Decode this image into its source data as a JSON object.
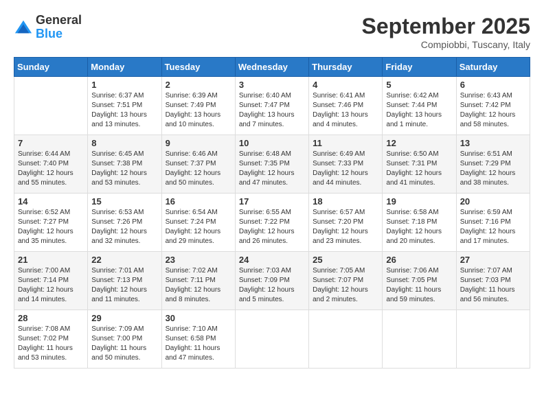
{
  "logo": {
    "general": "General",
    "blue": "Blue"
  },
  "header": {
    "month": "September 2025",
    "location": "Compiobbi, Tuscany, Italy"
  },
  "days_of_week": [
    "Sunday",
    "Monday",
    "Tuesday",
    "Wednesday",
    "Thursday",
    "Friday",
    "Saturday"
  ],
  "weeks": [
    [
      {
        "day": "",
        "sunrise": "",
        "sunset": "",
        "daylight": ""
      },
      {
        "day": "1",
        "sunrise": "Sunrise: 6:37 AM",
        "sunset": "Sunset: 7:51 PM",
        "daylight": "Daylight: 13 hours and 13 minutes."
      },
      {
        "day": "2",
        "sunrise": "Sunrise: 6:39 AM",
        "sunset": "Sunset: 7:49 PM",
        "daylight": "Daylight: 13 hours and 10 minutes."
      },
      {
        "day": "3",
        "sunrise": "Sunrise: 6:40 AM",
        "sunset": "Sunset: 7:47 PM",
        "daylight": "Daylight: 13 hours and 7 minutes."
      },
      {
        "day": "4",
        "sunrise": "Sunrise: 6:41 AM",
        "sunset": "Sunset: 7:46 PM",
        "daylight": "Daylight: 13 hours and 4 minutes."
      },
      {
        "day": "5",
        "sunrise": "Sunrise: 6:42 AM",
        "sunset": "Sunset: 7:44 PM",
        "daylight": "Daylight: 13 hours and 1 minute."
      },
      {
        "day": "6",
        "sunrise": "Sunrise: 6:43 AM",
        "sunset": "Sunset: 7:42 PM",
        "daylight": "Daylight: 12 hours and 58 minutes."
      }
    ],
    [
      {
        "day": "7",
        "sunrise": "Sunrise: 6:44 AM",
        "sunset": "Sunset: 7:40 PM",
        "daylight": "Daylight: 12 hours and 55 minutes."
      },
      {
        "day": "8",
        "sunrise": "Sunrise: 6:45 AM",
        "sunset": "Sunset: 7:38 PM",
        "daylight": "Daylight: 12 hours and 53 minutes."
      },
      {
        "day": "9",
        "sunrise": "Sunrise: 6:46 AM",
        "sunset": "Sunset: 7:37 PM",
        "daylight": "Daylight: 12 hours and 50 minutes."
      },
      {
        "day": "10",
        "sunrise": "Sunrise: 6:48 AM",
        "sunset": "Sunset: 7:35 PM",
        "daylight": "Daylight: 12 hours and 47 minutes."
      },
      {
        "day": "11",
        "sunrise": "Sunrise: 6:49 AM",
        "sunset": "Sunset: 7:33 PM",
        "daylight": "Daylight: 12 hours and 44 minutes."
      },
      {
        "day": "12",
        "sunrise": "Sunrise: 6:50 AM",
        "sunset": "Sunset: 7:31 PM",
        "daylight": "Daylight: 12 hours and 41 minutes."
      },
      {
        "day": "13",
        "sunrise": "Sunrise: 6:51 AM",
        "sunset": "Sunset: 7:29 PM",
        "daylight": "Daylight: 12 hours and 38 minutes."
      }
    ],
    [
      {
        "day": "14",
        "sunrise": "Sunrise: 6:52 AM",
        "sunset": "Sunset: 7:27 PM",
        "daylight": "Daylight: 12 hours and 35 minutes."
      },
      {
        "day": "15",
        "sunrise": "Sunrise: 6:53 AM",
        "sunset": "Sunset: 7:26 PM",
        "daylight": "Daylight: 12 hours and 32 minutes."
      },
      {
        "day": "16",
        "sunrise": "Sunrise: 6:54 AM",
        "sunset": "Sunset: 7:24 PM",
        "daylight": "Daylight: 12 hours and 29 minutes."
      },
      {
        "day": "17",
        "sunrise": "Sunrise: 6:55 AM",
        "sunset": "Sunset: 7:22 PM",
        "daylight": "Daylight: 12 hours and 26 minutes."
      },
      {
        "day": "18",
        "sunrise": "Sunrise: 6:57 AM",
        "sunset": "Sunset: 7:20 PM",
        "daylight": "Daylight: 12 hours and 23 minutes."
      },
      {
        "day": "19",
        "sunrise": "Sunrise: 6:58 AM",
        "sunset": "Sunset: 7:18 PM",
        "daylight": "Daylight: 12 hours and 20 minutes."
      },
      {
        "day": "20",
        "sunrise": "Sunrise: 6:59 AM",
        "sunset": "Sunset: 7:16 PM",
        "daylight": "Daylight: 12 hours and 17 minutes."
      }
    ],
    [
      {
        "day": "21",
        "sunrise": "Sunrise: 7:00 AM",
        "sunset": "Sunset: 7:14 PM",
        "daylight": "Daylight: 12 hours and 14 minutes."
      },
      {
        "day": "22",
        "sunrise": "Sunrise: 7:01 AM",
        "sunset": "Sunset: 7:13 PM",
        "daylight": "Daylight: 12 hours and 11 minutes."
      },
      {
        "day": "23",
        "sunrise": "Sunrise: 7:02 AM",
        "sunset": "Sunset: 7:11 PM",
        "daylight": "Daylight: 12 hours and 8 minutes."
      },
      {
        "day": "24",
        "sunrise": "Sunrise: 7:03 AM",
        "sunset": "Sunset: 7:09 PM",
        "daylight": "Daylight: 12 hours and 5 minutes."
      },
      {
        "day": "25",
        "sunrise": "Sunrise: 7:05 AM",
        "sunset": "Sunset: 7:07 PM",
        "daylight": "Daylight: 12 hours and 2 minutes."
      },
      {
        "day": "26",
        "sunrise": "Sunrise: 7:06 AM",
        "sunset": "Sunset: 7:05 PM",
        "daylight": "Daylight: 11 hours and 59 minutes."
      },
      {
        "day": "27",
        "sunrise": "Sunrise: 7:07 AM",
        "sunset": "Sunset: 7:03 PM",
        "daylight": "Daylight: 11 hours and 56 minutes."
      }
    ],
    [
      {
        "day": "28",
        "sunrise": "Sunrise: 7:08 AM",
        "sunset": "Sunset: 7:02 PM",
        "daylight": "Daylight: 11 hours and 53 minutes."
      },
      {
        "day": "29",
        "sunrise": "Sunrise: 7:09 AM",
        "sunset": "Sunset: 7:00 PM",
        "daylight": "Daylight: 11 hours and 50 minutes."
      },
      {
        "day": "30",
        "sunrise": "Sunrise: 7:10 AM",
        "sunset": "Sunset: 6:58 PM",
        "daylight": "Daylight: 11 hours and 47 minutes."
      },
      {
        "day": "",
        "sunrise": "",
        "sunset": "",
        "daylight": ""
      },
      {
        "day": "",
        "sunrise": "",
        "sunset": "",
        "daylight": ""
      },
      {
        "day": "",
        "sunrise": "",
        "sunset": "",
        "daylight": ""
      },
      {
        "day": "",
        "sunrise": "",
        "sunset": "",
        "daylight": ""
      }
    ]
  ]
}
